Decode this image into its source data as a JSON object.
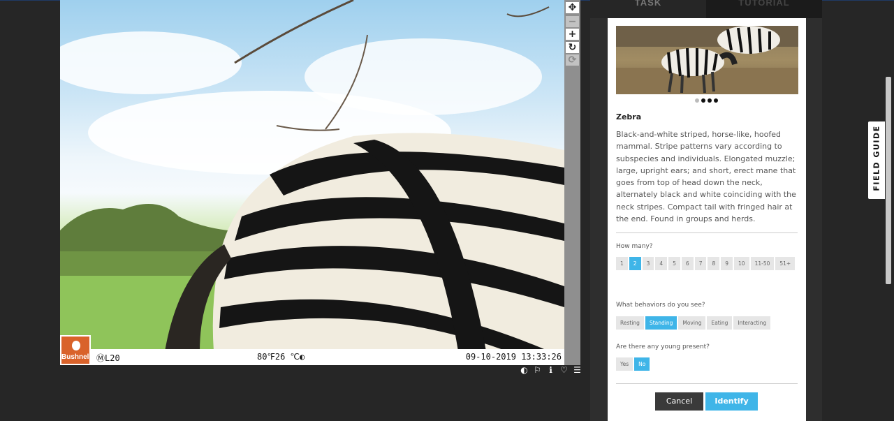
{
  "tabs": [
    {
      "label": "TASK",
      "active": true
    },
    {
      "label": "TUTORIAL",
      "active": false
    }
  ],
  "camera": {
    "brand": "Bushnell",
    "model": "ⓂL20",
    "temperature": "80℉26 ℃◐",
    "timestamp": "09-10-2019 13:33:26"
  },
  "zoom_controls": {
    "pan": "✥",
    "zoom_out": "−",
    "zoom_in": "+",
    "rotate": "↻",
    "reset": "⟳"
  },
  "image_tools": [
    "contrast-icon",
    "flag-icon",
    "info-icon",
    "heart-icon",
    "list-icon"
  ],
  "species": {
    "name": "Zebra",
    "description": "Black-and-white striped, horse-like, hoofed mammal. Stripe patterns vary according to subspecies and individuals. Elongated muzzle; large, upright ears; and short, erect mane that goes from top of head down the neck, alternately black and white coinciding with the neck stripes. Compact tail with fringed hair at the end. Found in groups and herds.",
    "carousel_dots": 4,
    "carousel_active": [
      1,
      2,
      3
    ]
  },
  "questions": {
    "how_many": {
      "label": "How many?",
      "options": [
        "1",
        "2",
        "3",
        "4",
        "5",
        "6",
        "7",
        "8",
        "9",
        "10",
        "11-50",
        "51+"
      ],
      "selected": "2"
    },
    "behaviors": {
      "label": "What behaviors do you see?",
      "options": [
        "Resting",
        "Standing",
        "Moving",
        "Eating",
        "Interacting"
      ],
      "selected": "Standing"
    },
    "young": {
      "label": "Are there any young present?",
      "options": [
        "Yes",
        "No"
      ],
      "selected": "No"
    }
  },
  "buttons": {
    "cancel": "Cancel",
    "identify": "Identify"
  },
  "field_guide": "FIELD GUIDE",
  "colors": {
    "accent": "#3fb5e8",
    "background": "#262626",
    "card": "#ffffff"
  }
}
